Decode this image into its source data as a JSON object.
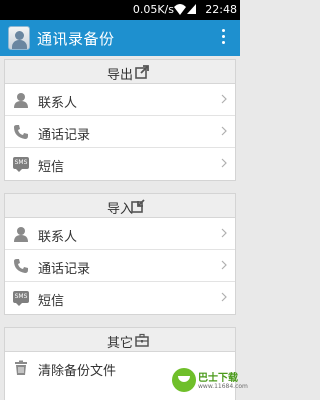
{
  "status_bar": {
    "speed": "0.05K/s",
    "time": "22:48"
  },
  "app_bar": {
    "title": "通讯录备份"
  },
  "sections": [
    {
      "header": "导出",
      "header_icon": "export-icon",
      "items": [
        {
          "label": "联系人",
          "icon": "person-icon"
        },
        {
          "label": "通话记录",
          "icon": "phone-icon"
        },
        {
          "label": "短信",
          "icon": "sms-icon",
          "icon_text": "SMS"
        }
      ]
    },
    {
      "header": "导入",
      "header_icon": "import-icon",
      "items": [
        {
          "label": "联系人",
          "icon": "person-icon"
        },
        {
          "label": "通话记录",
          "icon": "phone-icon"
        },
        {
          "label": "短信",
          "icon": "sms-icon",
          "icon_text": "SMS"
        }
      ]
    },
    {
      "header": "其它",
      "header_icon": "toolbox-icon",
      "items": [
        {
          "label": "清除备份文件",
          "icon": "trash-icon"
        }
      ]
    }
  ],
  "watermark": {
    "text": "巴士下载",
    "url": "www.11684.com"
  },
  "colors": {
    "app_bar": "#1e90cf",
    "background": "#e9e9e9",
    "header_bg": "#eeeeee"
  }
}
